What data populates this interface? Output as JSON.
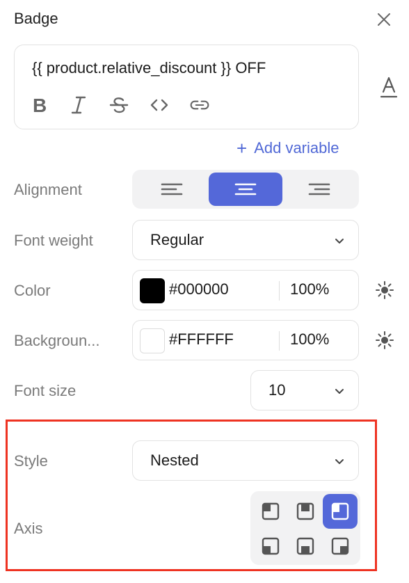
{
  "panel": {
    "title": "Badge",
    "close_icon": "close-icon"
  },
  "editor": {
    "text": "{{ product.relative_discount }} OFF",
    "toolbar": [
      "bold-icon",
      "italic-icon",
      "strikethrough-icon",
      "code-icon",
      "link-icon"
    ]
  },
  "text_color_icon": "text-color-icon",
  "add_variable": {
    "plus": "+",
    "label": "Add variable"
  },
  "alignment": {
    "label": "Alignment",
    "options": [
      "align-left-icon",
      "align-center-icon",
      "align-right-icon"
    ],
    "selected": "align-center-icon"
  },
  "font_weight": {
    "label": "Font weight",
    "value": "Regular"
  },
  "color": {
    "label": "Color",
    "hex": "#000000",
    "opacity": "100%",
    "swatch": "#000000"
  },
  "background": {
    "label": "Backgroun...",
    "hex": "#FFFFFF",
    "opacity": "100%",
    "swatch": "#FFFFFF"
  },
  "font_size": {
    "label": "Font size",
    "value": "10"
  },
  "style": {
    "label": "Style",
    "value": "Nested"
  },
  "axis": {
    "label": "Axis",
    "options": [
      "top-left",
      "top-center",
      "top-right",
      "bottom-left",
      "bottom-center",
      "bottom-right"
    ],
    "selected": "top-right"
  },
  "colors": {
    "accent": "#5468D9",
    "link": "#5068D6",
    "highlight": "#EE3322"
  }
}
